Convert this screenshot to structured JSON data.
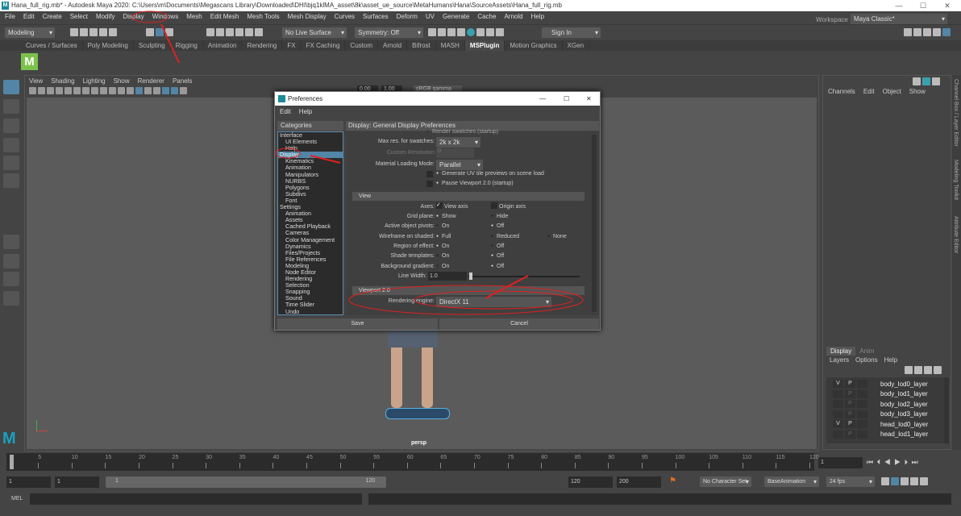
{
  "window": {
    "title": "Hana_full_rig.mb* - Autodesk Maya 2020: C:\\Users\\m\\Documents\\Megascans Library\\Downloaded\\DHI\\bjq1klMA_asset\\8k\\asset_ue_source\\MetaHumans\\Hana\\SourceAssets\\Hana_full_rig.mb",
    "logo": "M",
    "minimize": "—",
    "maximize": "☐",
    "close": "✕"
  },
  "menu": [
    "File",
    "Edit",
    "Create",
    "Select",
    "Modify",
    "Display",
    "Windows",
    "Mesh",
    "Edit Mesh",
    "Mesh Tools",
    "Mesh Display",
    "Curves",
    "Surfaces",
    "Deform",
    "UV",
    "Generate",
    "Cache",
    "Arnold",
    "Help"
  ],
  "status": {
    "mode": "Modeling",
    "live_surface": "No Live Surface",
    "symmetry": "Symmetry: Off",
    "sign_in": "Sign In",
    "workspace_label": "Workspace :",
    "workspace": "Maya Classic*"
  },
  "shelf_tabs": [
    "Curves / Surfaces",
    "Poly Modeling",
    "Sculpting",
    "Rigging",
    "Animation",
    "Rendering",
    "FX",
    "FX Caching",
    "Custom",
    "Arnold",
    "Bifrost",
    "MASH",
    "MSPlugin",
    "Motion Graphics",
    "XGen"
  ],
  "shelf_active": "MSPlugin",
  "shelf_icon": "M",
  "viewport": {
    "menu": [
      "View",
      "Shading",
      "Lighting",
      "Show",
      "Renderer",
      "Panels"
    ],
    "camera": "persp",
    "exposure": "0.00",
    "gamma": "1.00",
    "colorspace": "sRGB gamma"
  },
  "channel_box": {
    "menu": [
      "Channels",
      "Edit",
      "Object",
      "Show"
    ],
    "vtabs": [
      "Channel Box / Layer Editor",
      "Modeling Toolkit",
      "Attribute Editor"
    ]
  },
  "layer_editor": {
    "tabs": [
      "Display",
      "Anim"
    ],
    "menu": [
      "Layers",
      "Options",
      "Help"
    ],
    "layers": [
      {
        "v": "V",
        "p": "P",
        "name": "body_lod0_layer"
      },
      {
        "v": "",
        "p": "P",
        "name": "body_lod1_layer"
      },
      {
        "v": "",
        "p": "P",
        "name": "body_lod2_layer"
      },
      {
        "v": "",
        "p": "P",
        "name": "body_lod3_layer"
      },
      {
        "v": "V",
        "p": "P",
        "name": "head_lod0_layer"
      },
      {
        "v": "",
        "p": "P",
        "name": "head_lod1_layer"
      }
    ]
  },
  "timeline": {
    "ticks": [
      "1",
      "5",
      "10",
      "15",
      "20",
      "25",
      "30",
      "35",
      "40",
      "45",
      "50",
      "55",
      "60",
      "65",
      "70",
      "75",
      "80",
      "85",
      "90",
      "95",
      "100",
      "105",
      "110",
      "115",
      "120"
    ],
    "current": "1"
  },
  "range": {
    "start": "1",
    "anim_start": "1",
    "slider_start": "1",
    "slider_end": "120",
    "end": "120",
    "anim_end": "200",
    "character_set": "No Character Set",
    "anim_layer": "BaseAnimation",
    "fps": "24 fps"
  },
  "mel": {
    "label": "MEL"
  },
  "prefs": {
    "title": "Preferences",
    "menu": [
      "Edit",
      "Help"
    ],
    "categories_header": "Categories",
    "section_header": "Display: General Display Preferences",
    "categories": [
      {
        "t": "Interface",
        "sub": false
      },
      {
        "t": "UI Elements",
        "sub": true
      },
      {
        "t": "Help",
        "sub": true
      },
      {
        "t": "Display",
        "sub": false,
        "sel": true
      },
      {
        "t": "Kinematics",
        "sub": true
      },
      {
        "t": "Animation",
        "sub": true
      },
      {
        "t": "Manipulators",
        "sub": true
      },
      {
        "t": "NURBS",
        "sub": true
      },
      {
        "t": "Polygons",
        "sub": true
      },
      {
        "t": "Subdivs",
        "sub": true
      },
      {
        "t": "Font",
        "sub": true
      },
      {
        "t": "Settings",
        "sub": false
      },
      {
        "t": "Animation",
        "sub": true
      },
      {
        "t": "Assets",
        "sub": true
      },
      {
        "t": "Cached Playback",
        "sub": true
      },
      {
        "t": "Cameras",
        "sub": true
      },
      {
        "t": "Color Management",
        "sub": true
      },
      {
        "t": "Dynamics",
        "sub": true
      },
      {
        "t": "Files/Projects",
        "sub": true
      },
      {
        "t": "File References",
        "sub": true
      },
      {
        "t": "Modeling",
        "sub": true
      },
      {
        "t": "Node Editor",
        "sub": true
      },
      {
        "t": "Rendering",
        "sub": true
      },
      {
        "t": "Selection",
        "sub": true
      },
      {
        "t": "Snapping",
        "sub": true
      },
      {
        "t": "Sound",
        "sub": true
      },
      {
        "t": "Time Slider",
        "sub": true
      },
      {
        "t": "Undo",
        "sub": true
      }
    ],
    "render_swatches": "Render swatches (startup)",
    "max_res_label": "Max res. for swatches:",
    "max_res": "2k x 2k",
    "custom_res_label": "Custom Resolution",
    "custom_res": "0",
    "mat_loading_label": "Material Loading Mode:",
    "mat_loading": "Parallel",
    "gen_uv": "Generate UV tile previews on scene load",
    "pause_vp": "Pause Viewport 2.0 (startup)",
    "view_section": "View",
    "axes_label": "Axes:",
    "view_axis": "View axis",
    "origin_axis": "Origin axis",
    "grid_label": "Grid plane:",
    "show": "Show",
    "hide": "Hide",
    "pivots_label": "Active object pivots:",
    "wire_label": "Wireframe on shaded:",
    "full": "Full",
    "reduced": "Reduced",
    "none": "None",
    "region_label": "Region of effect:",
    "shade_label": "Shade templates:",
    "bg_label": "Background gradient:",
    "on": "On",
    "off": "Off",
    "line_width_label": "Line Width:",
    "line_width": "1.0",
    "vp2_section": "Viewport 2.0",
    "engine_label": "Rendering engine:",
    "engine": "DirectX 11",
    "save": "Save",
    "cancel": "Cancel"
  },
  "colors": {
    "accent": "#5285a6",
    "annotation": "#e02020"
  }
}
